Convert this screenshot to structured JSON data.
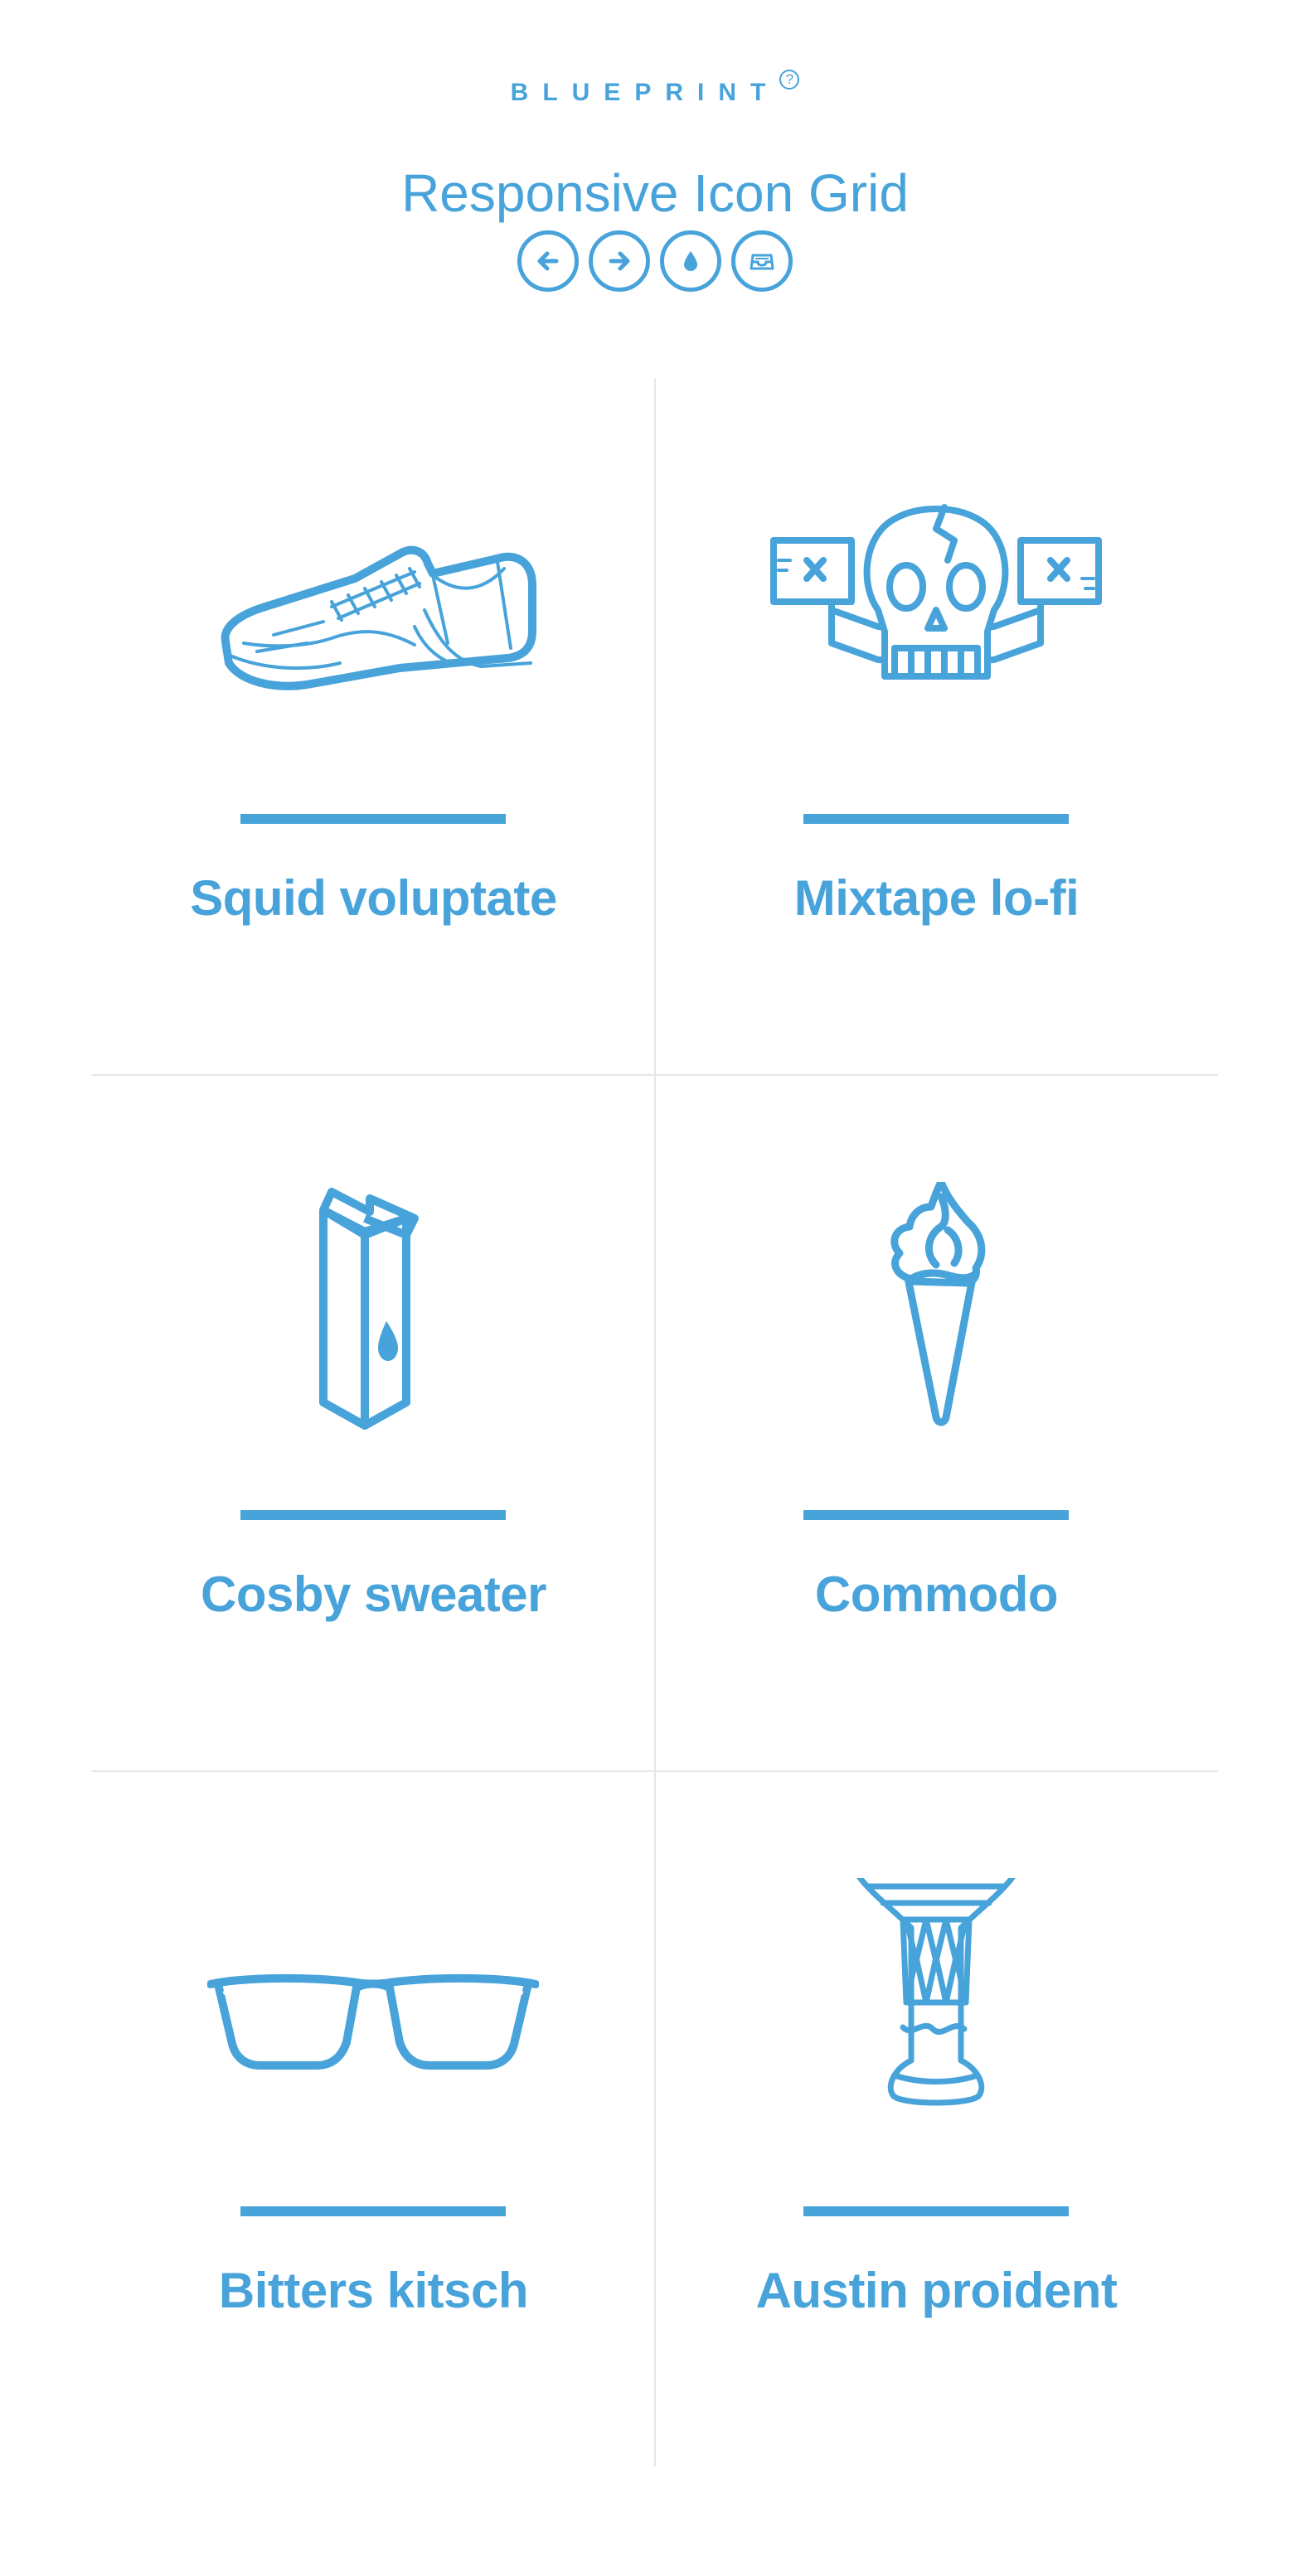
{
  "header": {
    "brand": "BLUEPRINT",
    "brand_mark": "?",
    "title": "Responsive Icon Grid"
  },
  "nav": [
    {
      "icon": "arrow-left-icon"
    },
    {
      "icon": "arrow-right-icon"
    },
    {
      "icon": "drop-icon"
    },
    {
      "icon": "archive-icon"
    }
  ],
  "grid": {
    "items": [
      {
        "icon": "sneaker-icon",
        "label": "Squid voluptate"
      },
      {
        "icon": "skull-banner-icon",
        "label": "Mixtape lo-fi"
      },
      {
        "icon": "milk-carton-icon",
        "label": "Cosby sweater"
      },
      {
        "icon": "ice-cream-cone-icon",
        "label": "Commodo"
      },
      {
        "icon": "glasses-icon",
        "label": "Bitters kitsch"
      },
      {
        "icon": "djembe-drum-icon",
        "label": "Austin proident"
      }
    ]
  },
  "colors": {
    "accent": "#47a3da",
    "divider": "#e4e7ea",
    "background": "#ffffff"
  }
}
